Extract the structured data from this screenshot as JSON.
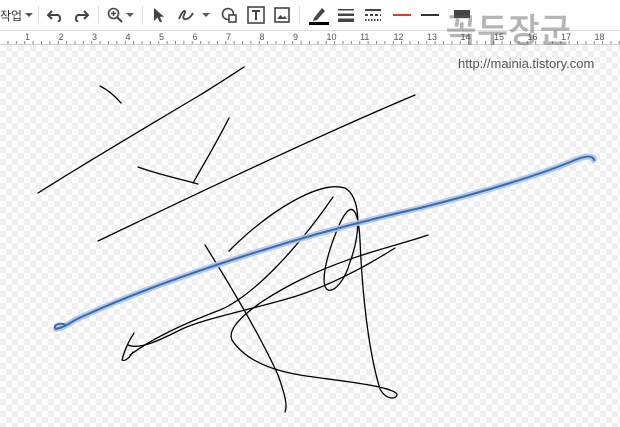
{
  "toolbar": {
    "menu_label": "작업",
    "tools": [
      {
        "name": "undo-icon"
      },
      {
        "name": "redo-icon"
      },
      {
        "name": "zoom-icon"
      },
      {
        "name": "select-icon"
      },
      {
        "name": "line-tool-icon"
      },
      {
        "name": "shape-icon"
      },
      {
        "name": "textbox-icon"
      },
      {
        "name": "image-icon"
      },
      {
        "name": "line-color-icon"
      },
      {
        "name": "line-weight-icon"
      },
      {
        "name": "line-dash-icon"
      },
      {
        "name": "line-start-icon"
      },
      {
        "name": "line-end-icon"
      }
    ]
  },
  "ruler": {
    "numbers": [
      "1",
      "2",
      "3",
      "4",
      "5",
      "6",
      "7",
      "8",
      "9",
      "10",
      "11",
      "12",
      "13",
      "14",
      "15",
      "16",
      "17",
      "18"
    ]
  },
  "watermark": {
    "title": "꼭두장군",
    "url": "http://mainia.tistory.com"
  },
  "colors": {
    "selected_stroke": "#3c6db0",
    "selection_glow": "#a9c4ea",
    "ink": "#000000"
  }
}
